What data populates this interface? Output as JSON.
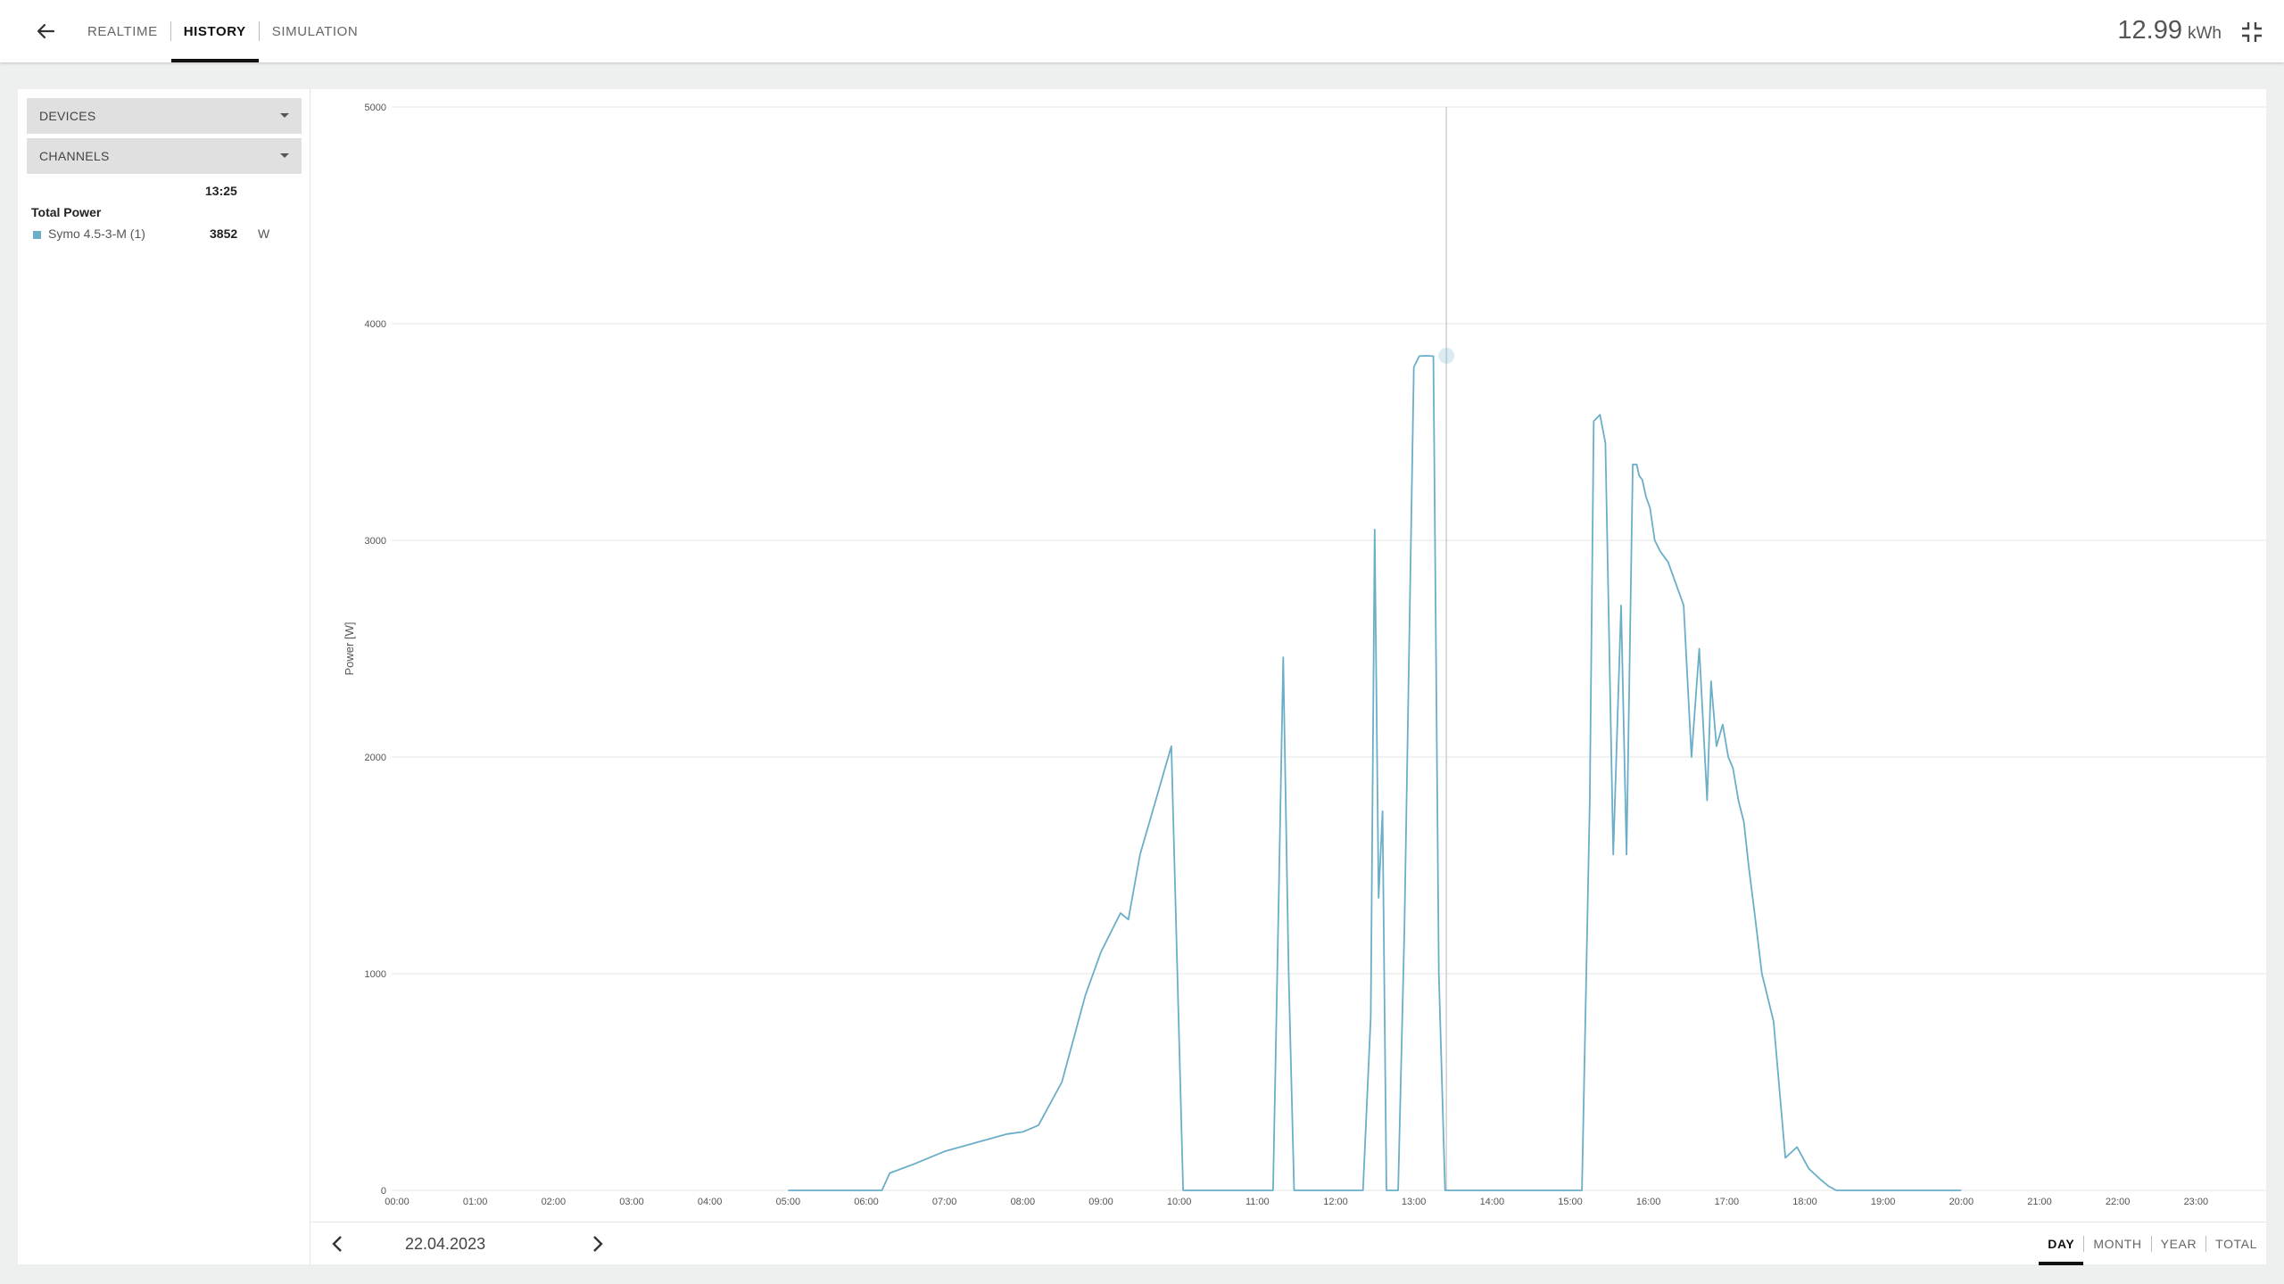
{
  "header": {
    "tabs": [
      {
        "label": "REALTIME",
        "active": false
      },
      {
        "label": "HISTORY",
        "active": true
      },
      {
        "label": "SIMULATION",
        "active": false
      }
    ],
    "energy_value": "12.99",
    "energy_unit": "kWh",
    "back_icon": "arrow-left-icon",
    "compress_icon": "fullscreen-exit-icon"
  },
  "sidebar": {
    "devices_label": "DEVICES",
    "channels_label": "CHANNELS",
    "legend": {
      "time": "13:25",
      "group": "Total Power",
      "items": [
        {
          "name": "Symo 4.5-3-M (1)",
          "value": "3852",
          "unit": "W",
          "color": "#6aaec8"
        }
      ]
    }
  },
  "footer": {
    "date": "22.04.2023",
    "periods": [
      {
        "label": "DAY",
        "active": true
      },
      {
        "label": "MONTH",
        "active": false
      },
      {
        "label": "YEAR",
        "active": false
      },
      {
        "label": "TOTAL",
        "active": false
      }
    ]
  },
  "chart_data": {
    "type": "line",
    "ylabel": "Power [W]",
    "ylim": [
      0,
      5000
    ],
    "yticks": [
      0,
      1000,
      2000,
      3000,
      4000,
      5000
    ],
    "xlim": [
      0,
      24
    ],
    "xticks": [
      "00:00",
      "01:00",
      "02:00",
      "03:00",
      "04:00",
      "05:00",
      "06:00",
      "07:00",
      "08:00",
      "09:00",
      "10:00",
      "11:00",
      "12:00",
      "13:00",
      "14:00",
      "15:00",
      "16:00",
      "17:00",
      "18:00",
      "19:00",
      "20:00",
      "21:00",
      "22:00",
      "23:00"
    ],
    "grid": true,
    "crosshair_time": "13:25",
    "series": [
      {
        "name": "Symo 4.5-3-M (1)",
        "color": "#6aaec8",
        "x": [
          5.0,
          6.2,
          6.3,
          6.6,
          7.0,
          7.4,
          7.8,
          8.0,
          8.2,
          8.5,
          8.8,
          9.0,
          9.25,
          9.35,
          9.5,
          9.7,
          9.9,
          10.05,
          10.15,
          10.3,
          10.45,
          10.5,
          11.2,
          11.27,
          11.33,
          11.4,
          11.47,
          11.55,
          12.35,
          12.45,
          12.5,
          12.55,
          12.6,
          12.65,
          12.72,
          12.8,
          12.88,
          13.0,
          13.07,
          13.15,
          13.25,
          13.32,
          13.4,
          13.5,
          13.55,
          15.15,
          15.25,
          15.3,
          15.38,
          15.45,
          15.55,
          15.65,
          15.72,
          15.8,
          15.85,
          15.88,
          15.92,
          15.97,
          16.02,
          16.08,
          16.15,
          16.25,
          16.35,
          16.45,
          16.55,
          16.65,
          16.75,
          16.8,
          16.87,
          16.95,
          17.02,
          17.08,
          17.15,
          17.22,
          17.28,
          17.35,
          17.45,
          17.6,
          17.75,
          17.9,
          18.05,
          18.2,
          18.3,
          18.4,
          18.55,
          18.65,
          18.75,
          18.85,
          19.0,
          19.2,
          19.4,
          19.6,
          19.8,
          20.0
        ],
        "y": [
          0,
          0,
          80,
          120,
          180,
          220,
          260,
          270,
          300,
          500,
          900,
          1100,
          1280,
          1250,
          1550,
          1800,
          2050,
          0,
          0,
          0,
          0,
          0,
          0,
          1300,
          2460,
          1000,
          0,
          0,
          0,
          800,
          3050,
          1350,
          1750,
          0,
          0,
          0,
          1200,
          3800,
          3850,
          3852,
          3850,
          1000,
          0,
          0,
          0,
          0,
          1800,
          3550,
          3580,
          3450,
          1550,
          2700,
          1550,
          3350,
          3350,
          3300,
          3280,
          3200,
          3150,
          3000,
          2950,
          2900,
          2800,
          2700,
          2000,
          2500,
          1800,
          2350,
          2050,
          2150,
          2000,
          1950,
          1800,
          1700,
          1500,
          1300,
          1000,
          780,
          150,
          200,
          100,
          50,
          20,
          0,
          0,
          0,
          0,
          0,
          0,
          0,
          0,
          0,
          0,
          0
        ]
      }
    ]
  }
}
